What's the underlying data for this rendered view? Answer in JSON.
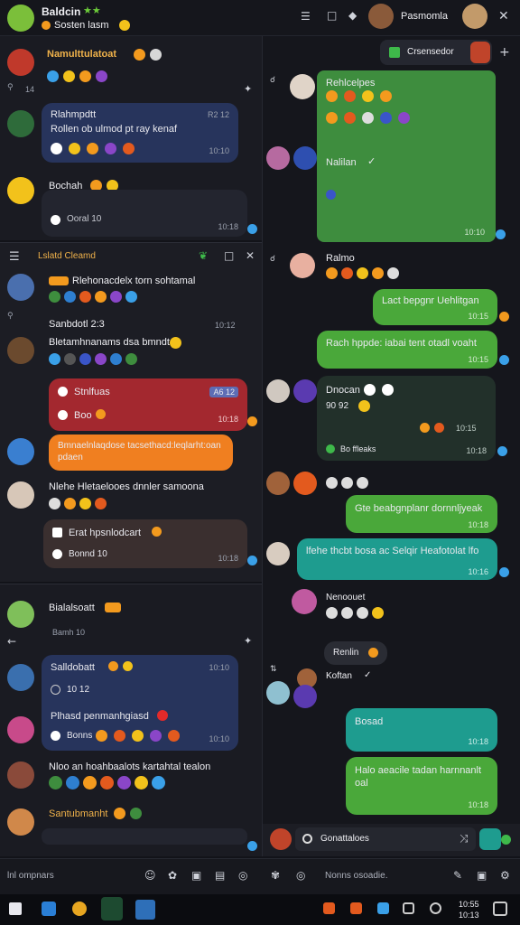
{
  "header": {
    "title": "Baldcin",
    "subtitle": "Sosten lasm",
    "right_name": "Pasmomla"
  },
  "top_right": {
    "compose_label": "Crsensedor"
  },
  "left_top": [
    {
      "name": "Namulttulatoat",
      "time": "14"
    },
    {
      "line1": "Rlahmpdtt",
      "line1_time": "R2 12",
      "line2": "Rollen ob ulmod pt ray kenaf",
      "time": "10:10"
    },
    {
      "name": "Bochah",
      "line": "Ooral 10",
      "time": "10:18"
    }
  ],
  "left_mid": {
    "title": "Lslatd Cleamd",
    "rows": [
      {
        "name": "Rlehonacdelx torn sohtamal",
        "time": "10:12"
      },
      {
        "name": "Sanbdotl 2:3"
      },
      {
        "name": "Bletamhnanams dsa bmndt",
        "time": "10:12"
      }
    ],
    "red_bubble": {
      "title": "Stnlfuas",
      "badge": "A6 12",
      "line": "Boo",
      "time": "10:18"
    },
    "orange_bubble": "Bmnaelnlaqdose tacsethacd:leqlarht:oanpdaen",
    "row4": "Nlehe Hletaelooes dnnler samoona",
    "dark_bubble": {
      "title": "Erat hpsnlodcart",
      "line": "Bonnd 10",
      "time": "10:18"
    }
  },
  "left_bot": {
    "rows": [
      {
        "name": "Bialalsoatt",
        "sub": "Bamh 10"
      },
      {
        "name": "Salldobatt",
        "time": "10:10"
      }
    ],
    "blue_bubble": {
      "time1": "10 12",
      "line": "Plhasd penmanhgiasd",
      "sub": "Bonns",
      "time": "10:10"
    },
    "row3": "Nloo an hoahbaalots kartahtal tealon",
    "row4": "Santubmanht"
  },
  "right": {
    "msgs": [
      {
        "name": "Rehlcelpes",
        "time": "10:10"
      },
      {
        "name": "Nalilan"
      },
      {
        "name": "Ralmo"
      },
      {
        "bubble": "Lact bepgnr Uehlitgan",
        "time": "10:15"
      },
      {
        "bubble": "Rach hppde: iabai tent otadl voaht",
        "time": "10:15"
      },
      {
        "name": "Dnocan",
        "line": "90 92",
        "sub": "Bo ffleaks",
        "time": "10:18"
      },
      {
        "bubble": "Gte beabgnplanr dornnljyeak",
        "time": "10:18"
      },
      {
        "bubble": "lfehe thcbt bosa ac Selqir Heafotolat lfo",
        "time": "10:16"
      },
      {
        "name": "Nenoouet"
      },
      {
        "name": "Renlin"
      },
      {
        "name": "Koftan"
      },
      {
        "bubble": "Bosad",
        "time": "10:18"
      },
      {
        "bubble": "Halo aeacile tadan harnnanlt oal",
        "time": "10:18"
      }
    ],
    "composer": "Gonattaloes"
  },
  "bottom_input_left": "lnl ompnars",
  "bottom_input_right": "Nonns osoadie.",
  "taskbar": {
    "time": "10:55",
    "date": "10:13"
  },
  "colors": {
    "green": "#3e8d3e",
    "blue": "#2c3a6b",
    "red": "#a3282f",
    "orange": "#f07f20",
    "teal": "#1e9c8f"
  }
}
